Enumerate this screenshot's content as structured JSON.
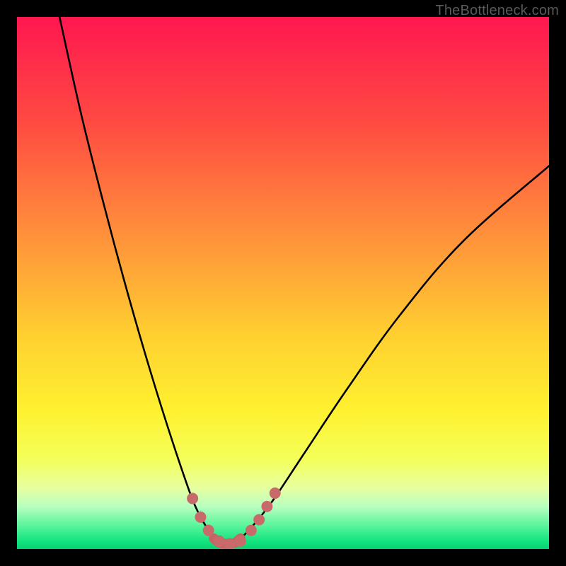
{
  "watermark": "TheBottleneck.com",
  "chart_data": {
    "type": "line",
    "title": "",
    "xlabel": "",
    "ylabel": "",
    "xlim": [
      0,
      100
    ],
    "ylim": [
      0,
      100
    ],
    "grid": false,
    "legend": {
      "visible": false
    },
    "series": [
      {
        "name": "bottleneck-curve",
        "x": [
          8,
          12,
          16,
          20,
          24,
          28,
          32,
          34,
          36,
          37,
          38,
          39,
          40,
          41,
          42,
          44,
          48,
          54,
          62,
          72,
          84,
          100
        ],
        "y": [
          100,
          82,
          66,
          51,
          37,
          24,
          12,
          7,
          3.5,
          2,
          1.2,
          1,
          1,
          1.2,
          2,
          4,
          9,
          18,
          30,
          44,
          58,
          72
        ]
      }
    ],
    "markers": {
      "name": "highlight-dots",
      "color": "#c96a6a",
      "points": [
        {
          "x": 33.0,
          "y": 9.5
        },
        {
          "x": 34.5,
          "y": 6.0
        },
        {
          "x": 36.0,
          "y": 3.5
        },
        {
          "x": 38.0,
          "y": 1.5
        },
        {
          "x": 40.0,
          "y": 1.0
        },
        {
          "x": 42.0,
          "y": 1.5
        },
        {
          "x": 44.0,
          "y": 3.5
        },
        {
          "x": 45.5,
          "y": 5.5
        },
        {
          "x": 47.0,
          "y": 8.0
        },
        {
          "x": 48.5,
          "y": 10.5
        }
      ]
    },
    "background_gradient": {
      "stops": [
        {
          "offset": 0.0,
          "color": "#ff1750"
        },
        {
          "offset": 0.2,
          "color": "#ff4b42"
        },
        {
          "offset": 0.42,
          "color": "#ff943a"
        },
        {
          "offset": 0.6,
          "color": "#ffd030"
        },
        {
          "offset": 0.74,
          "color": "#fff130"
        },
        {
          "offset": 0.83,
          "color": "#f4ff58"
        },
        {
          "offset": 0.885,
          "color": "#e7ffa0"
        },
        {
          "offset": 0.92,
          "color": "#b8ffc0"
        },
        {
          "offset": 0.955,
          "color": "#5cf59c"
        },
        {
          "offset": 0.985,
          "color": "#12e47f"
        },
        {
          "offset": 1.0,
          "color": "#07d173"
        }
      ]
    }
  }
}
